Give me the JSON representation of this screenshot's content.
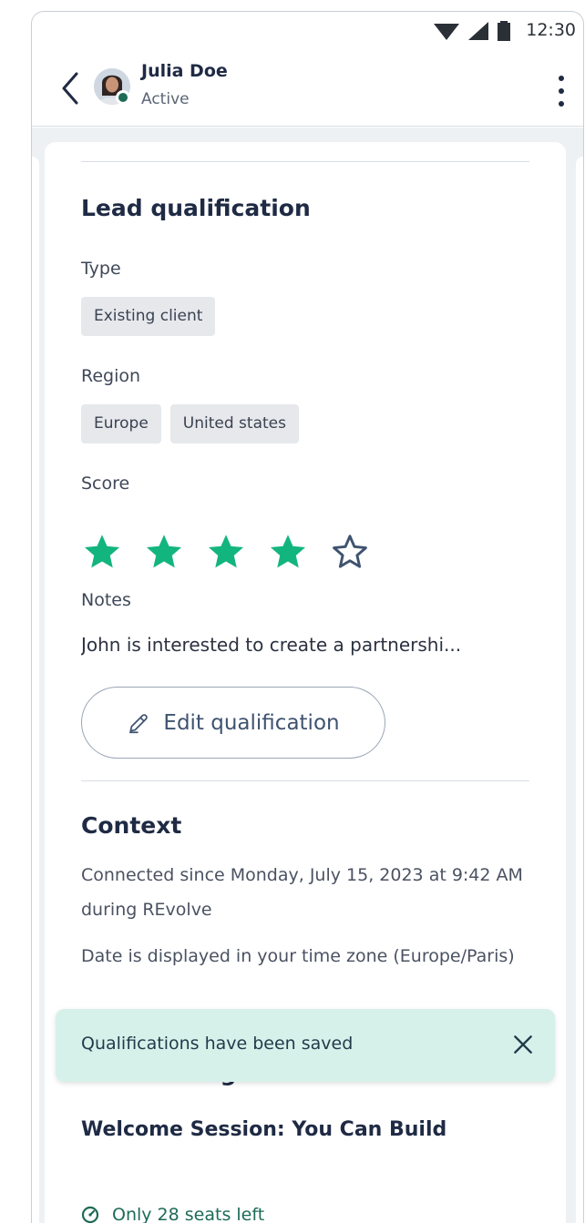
{
  "status_bar": {
    "time": "12:30",
    "icons": [
      "wifi-icon",
      "cellular-signal-icon",
      "battery-icon"
    ]
  },
  "header": {
    "user_name": "Julia Doe",
    "user_status": "Active",
    "presence_color": "#1d6b57"
  },
  "lead_qualification": {
    "title": "Lead qualification",
    "type_label": "Type",
    "type_values": [
      "Existing client"
    ],
    "region_label": "Region",
    "region_values": [
      "Europe",
      "United states"
    ],
    "score_label": "Score",
    "score": 4,
    "score_max": 5,
    "notes_label": "Notes",
    "notes_text": "John is interested to create a partnershi...",
    "edit_button_label": "Edit qualification"
  },
  "context": {
    "title": "Context",
    "connected_text": "Connected since Monday, July 15, 2023 at 9:42 AM during REvolve",
    "timezone_text": "Date is displayed in your time zone (Europe/Paris)"
  },
  "attending": {
    "title": "Is attending",
    "session_title": "Welcome Session: You Can Build",
    "seats_text": "Only 28 seats left"
  },
  "toast": {
    "message": "Qualifications have been saved"
  },
  "colors": {
    "accent_green": "#13b57e",
    "toast_bg": "#d6f1ea",
    "text_primary": "#1f2a44"
  }
}
